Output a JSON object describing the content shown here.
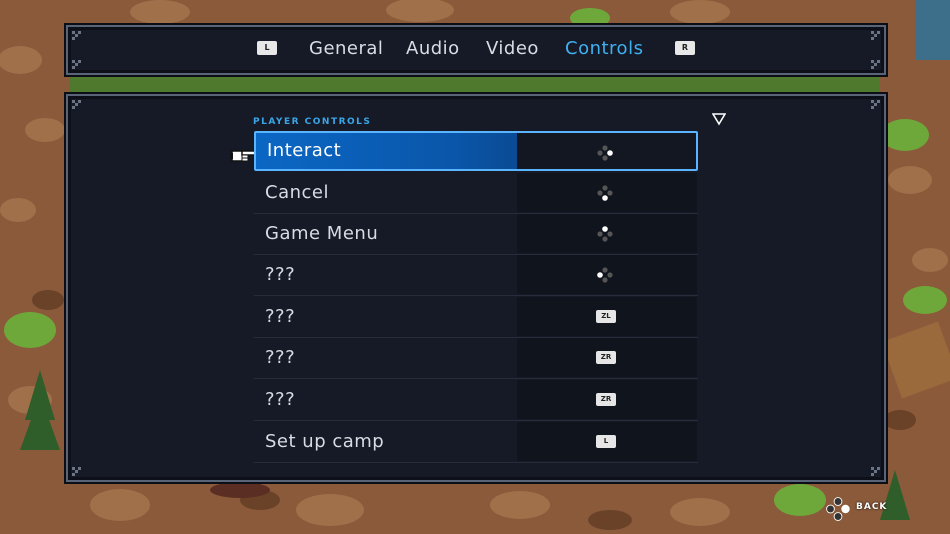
{
  "tabs": {
    "left_shoulder": "L",
    "right_shoulder": "R",
    "items": [
      {
        "label": "General"
      },
      {
        "label": "Audio"
      },
      {
        "label": "Video"
      },
      {
        "label": "Controls",
        "active": true
      }
    ]
  },
  "content": {
    "section_title": "PLAYER CONTROLS",
    "rows": [
      {
        "label": "Interact",
        "binding_icon": "dpad-right-icon",
        "selected": true
      },
      {
        "label": "Cancel",
        "binding_icon": "dpad-down-icon"
      },
      {
        "label": "Game Menu",
        "binding_icon": "dpad-up-icon"
      },
      {
        "label": "???",
        "binding_icon": "dpad-left-icon"
      },
      {
        "label": "???",
        "binding_key": "ZL"
      },
      {
        "label": "???",
        "binding_key": "ZR"
      },
      {
        "label": "???",
        "binding_key": "ZR"
      },
      {
        "label": "Set up camp",
        "binding_key": "L"
      }
    ]
  },
  "footer": {
    "back_label": "BACK",
    "back_icon": "dpad-right-icon"
  },
  "colors": {
    "accent": "#3fb0f0",
    "panel": "#151a26",
    "selected_row": "#0b67c4"
  }
}
